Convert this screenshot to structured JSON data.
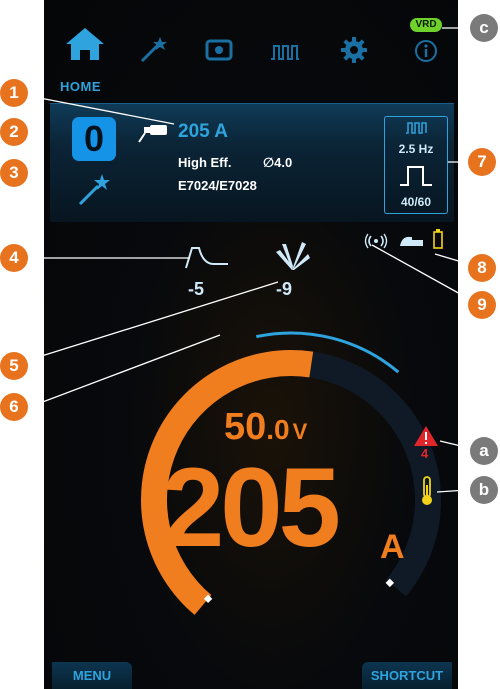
{
  "nav": {
    "tabs": [
      {
        "name": "home",
        "icon": "home-icon"
      },
      {
        "name": "wizard",
        "icon": "magic-wand-icon"
      },
      {
        "name": "memory",
        "icon": "memory-icon"
      },
      {
        "name": "pulse",
        "icon": "pulse-wave-icon"
      },
      {
        "name": "settings",
        "icon": "gear-icon"
      },
      {
        "name": "info",
        "icon": "info-icon"
      }
    ],
    "vrd_label": "VRD",
    "home_label": "HOME"
  },
  "job": {
    "number": "0",
    "current": "205 A",
    "mode": "High Eff.",
    "diameter_symbol": "∅",
    "diameter": "4.0",
    "electrode": "E7024/E7028"
  },
  "pulse_panel": {
    "frequency": "2.5 Hz",
    "ratio": "40/60"
  },
  "adjustments": {
    "hot_start": "-5",
    "arc_force": "-9"
  },
  "gauge": {
    "voltage_value": "50.0",
    "voltage_int": "50",
    "voltage_dec": ".0",
    "voltage_unit": "V",
    "current_value": "205",
    "current_unit": "A",
    "fill_fraction": 0.55
  },
  "alerts": {
    "warning_count": "4"
  },
  "bottom": {
    "menu_label": "MENU",
    "shortcut_label": "SHORTCUT"
  },
  "callouts": {
    "numbers": [
      "1",
      "2",
      "3",
      "4",
      "5",
      "6",
      "7",
      "8",
      "9"
    ],
    "letters": [
      "a",
      "b",
      "c"
    ]
  },
  "colors": {
    "accent_blue": "#2ea3de",
    "accent_orange": "#f07d1e",
    "vrd_green": "#6fd22a",
    "warning_red": "#e0262b",
    "callout_orange": "#e8731f",
    "callout_gray": "#7a7a7a"
  }
}
